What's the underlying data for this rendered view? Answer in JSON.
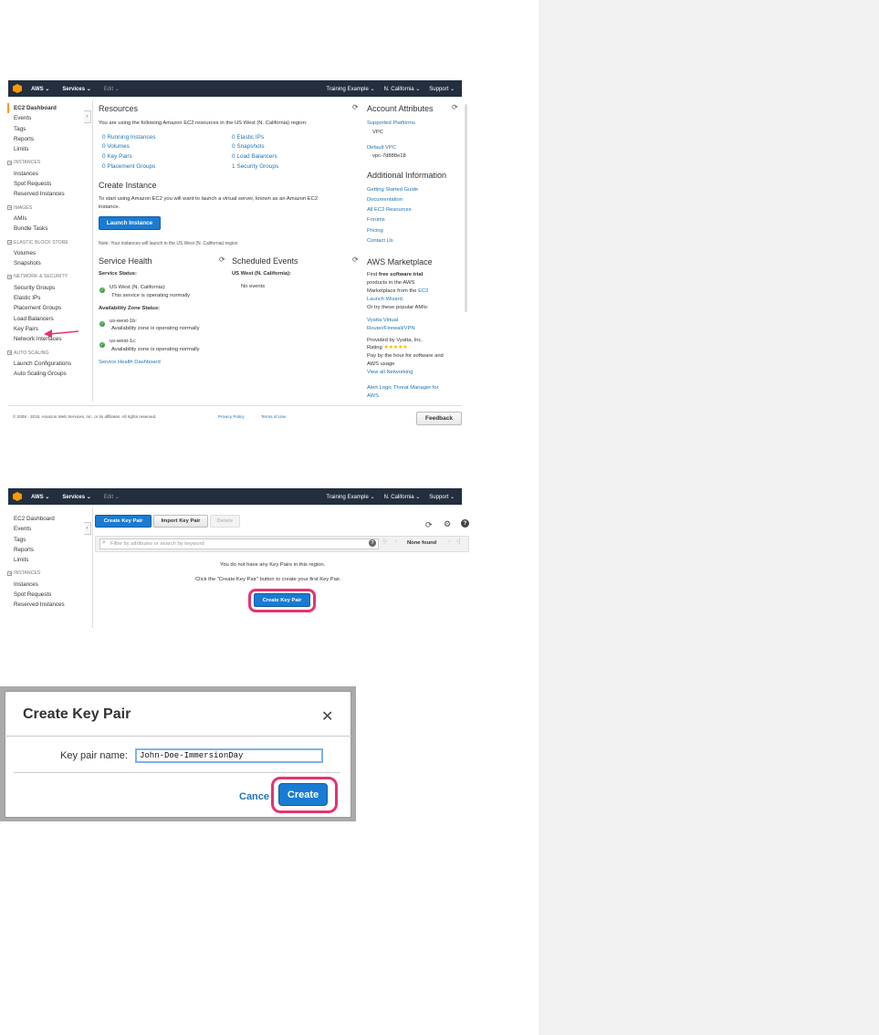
{
  "topbar": {
    "aws": "AWS ⌄",
    "services": "Services ⌄",
    "edit": "Edit ⌄",
    "account": "Training Example ⌄",
    "region": "N. California ⌄",
    "support": "Support ⌄"
  },
  "sidebar": {
    "top_items": [
      "EC2 Dashboard",
      "Events",
      "Tags",
      "Reports",
      "Limits"
    ],
    "instances_header": "INSTANCES",
    "instances": [
      "Instances",
      "Spot Requests",
      "Reserved Instances"
    ],
    "images_header": "IMAGES",
    "images": [
      "AMIs",
      "Bundle Tasks"
    ],
    "ebs_header": "ELASTIC BLOCK STORE",
    "ebs": [
      "Volumes",
      "Snapshots"
    ],
    "network_header": "NETWORK & SECURITY",
    "network": [
      "Security Groups",
      "Elastic IPs",
      "Placement Groups",
      "Load Balancers",
      "Key Pairs",
      "Network Interfaces"
    ],
    "autoscaling_header": "AUTO SCALING",
    "autoscaling": [
      "Launch Configurations",
      "Auto Scaling Groups"
    ]
  },
  "resources": {
    "title": "Resources",
    "intro": "You are using the following Amazon EC2 resources in the US West (N. California) region:",
    "left": [
      "0 Running Instances",
      "0 Volumes",
      "0 Key Pairs",
      "0 Placement Groups"
    ],
    "right": [
      "0 Elastic IPs",
      "0 Snapshots",
      "0 Load Balancers",
      "1 Security Groups"
    ]
  },
  "create_instance": {
    "title": "Create Instance",
    "text_line1": "To start using Amazon EC2 you will want to launch a virtual server, known as an Amazon EC2",
    "text_line2": "instance.",
    "button": "Launch Instance",
    "note": "Note: Your instances will launch in the US West (N. California) region"
  },
  "service_health": {
    "title": "Service Health",
    "status_label": "Service Status:",
    "region_name": "US West (N. California):",
    "region_status": "This service is operating normally",
    "az_label": "Availability Zone Status:",
    "zones": [
      {
        "name": "us-west-1b:",
        "status": "Availability zone is operating normally"
      },
      {
        "name": "us-west-1c:",
        "status": "Availability zone is operating normally"
      }
    ],
    "dashboard_link": "Service Health Dashboard"
  },
  "scheduled_events": {
    "title": "Scheduled Events",
    "region": "US West (N. California):",
    "value": "No events"
  },
  "account_attributes": {
    "title": "Account Attributes",
    "platforms_link": "Supported Platforms",
    "platforms_value": "VPC",
    "vpc_link": "Default VPC",
    "vpc_value": "vpc-7d888e18"
  },
  "additional_info": {
    "title": "Additional Information",
    "links": [
      "Getting Started Guide",
      "Documentation",
      "All EC2 Resources",
      "Forums",
      "Pricing",
      "Contact Us"
    ]
  },
  "marketplace": {
    "title": "AWS Marketplace",
    "line1_pre": "Find ",
    "line1_bold": "free software trial",
    "line2": "products in the AWS",
    "line3_pre": "Marketplace from the ",
    "line3_link": "EC2",
    "line4_link": "Launch Wizard.",
    "line5": "Or try these popular AMIs:",
    "ami1_line1": "Vyatta Virtual",
    "ami1_line2": "Router/Firewall/VPN",
    "provided": "Provided by Vyatta, Inc.",
    "rating_label": "Rating ",
    "rating_stars": "★★★★★",
    "pay_line1": "Pay by the hour for software and",
    "pay_line2": "AWS usage",
    "view_all": "View all Networking",
    "ami2_line1": "Alert Logic Threat Manager for",
    "ami2_line2": "AWS"
  },
  "footer": {
    "copyright": "© 2008 - 2015, Amazon Web Services, Inc. or its affiliates. All rights reserved.",
    "privacy": "Privacy Policy",
    "terms": "Terms of Use",
    "feedback": "Feedback"
  },
  "keypairs": {
    "create_button": "Create Key Pair",
    "import_button": "Import Key Pair",
    "delete_button": "Delete",
    "filter_placeholder": "Filter by attributes or search by keyword",
    "pager_status": "None found",
    "empty_message": "You do not have any Key Pairs in this region.",
    "empty_hint": "Click the \"Create Key Pair\" button to create your first Key Pair.",
    "center_button": "Create Key Pair"
  },
  "modal": {
    "title": "Create Key Pair",
    "label": "Key pair name:",
    "input_value": "John-Doe-ImmersionDay",
    "cancel": "Cance",
    "create": "Create"
  },
  "colors": {
    "aws_nav": "#232f3e",
    "aws_orange": "#ff9900",
    "link_blue": "#2274b3",
    "button_blue": "#1a7bd3",
    "highlight_pink": "#e6336e",
    "ok_green": "#3ea34a"
  }
}
